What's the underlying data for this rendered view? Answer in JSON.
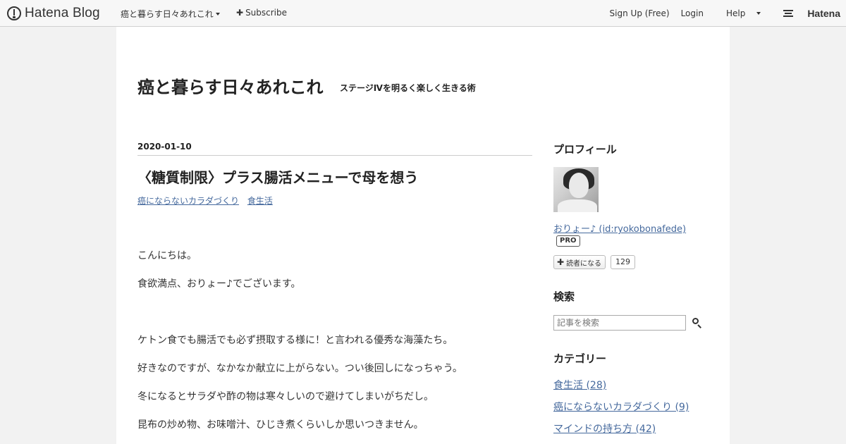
{
  "global_header": {
    "logo_text": "Hatena Blog",
    "blog_name": "癌と暮らす日々あれこれ",
    "subscribe_label": "Subscribe",
    "signup_label": "Sign Up (Free)",
    "login_label": "Login",
    "help_label": "Help",
    "hatena_label": "Hatena"
  },
  "blog": {
    "title": "癌と暮らす日々あれこれ",
    "description": "ステージⅣを明るく楽しく生きる術"
  },
  "entry": {
    "date": "2020-01-10",
    "title": "〈糖質制限〉プラス腸活メニューで母を想う",
    "categories": [
      "癌にならないカラダづくり",
      "食生活"
    ],
    "paragraphs": [
      "こんにちは。",
      "食欲満点、おりょー♪でございます。",
      "ケトン食でも腸活でも必ず摂取する様に！と言われる優秀な海藻たち。",
      "好きなのですが、なかなか献立に上がらない。つい後回しになっちゃう。",
      "冬になるとサラダや酢の物は寒々しいので避けてしまいがちだし。",
      "昆布の炒め物、お味噌汁、ひじき煮くらいしか思いつきません。"
    ]
  },
  "sidebar": {
    "profile_heading": "プロフィール",
    "profile_name": "おりょー♪ (id:ryokobonafede)",
    "pro_badge": "PRO",
    "subscribe_button": "読者になる",
    "subscriber_count": "129",
    "search_heading": "検索",
    "search_placeholder": "記事を検索",
    "category_heading": "カテゴリー",
    "categories": [
      "食生活 (28)",
      "癌にならないカラダづくり (9)",
      "マインドの持ち方 (42)"
    ]
  }
}
